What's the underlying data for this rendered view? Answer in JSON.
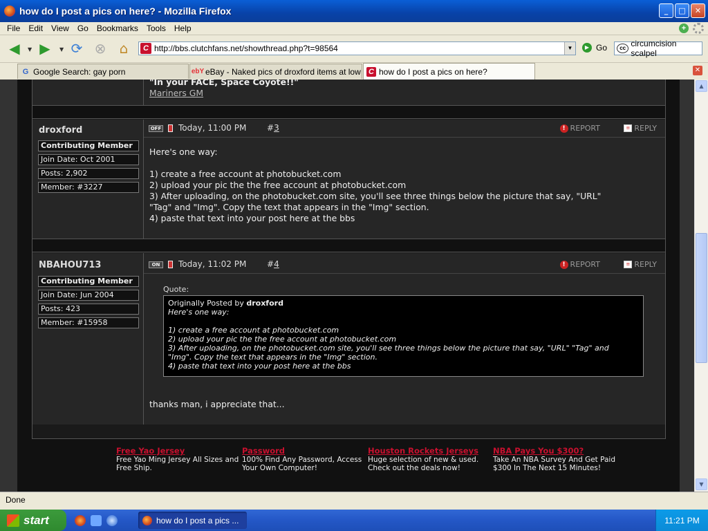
{
  "window": {
    "title": "how do I post a pics on here? - Mozilla Firefox"
  },
  "menu": [
    "File",
    "Edit",
    "View",
    "Go",
    "Bookmarks",
    "Tools",
    "Help"
  ],
  "toolbar": {
    "url": "http://bbs.clutchfans.net/showthread.php?t=98564",
    "go_label": "Go",
    "search_value": "circumcision scalpel"
  },
  "tabs": [
    {
      "label": "Google Search: gay porn",
      "icon": "google-icon"
    },
    {
      "label": "eBay - Naked pics of droxford items at low ...",
      "icon": "ebay-icon"
    },
    {
      "label": "how do I post a pics on here?",
      "icon": "clutchfans-icon",
      "active": true
    }
  ],
  "prev_post": {
    "signature_bold": "\"In your FACE, Space Coyote!!\"",
    "signature_link": "Mariners GM"
  },
  "posts": [
    {
      "username": "droxford",
      "user_title": "Contributing Member",
      "join_date": "Join Date: Oct 2001",
      "posts": "Posts: 2,902",
      "member": "Member: #3227",
      "status": "OFF",
      "date": "Today, 11:00 PM",
      "number_prefix": "#",
      "number": "3",
      "report_label": "REPORT",
      "reply_label": "REPLY",
      "body": "Here's one way:\n\n1) create a free account at photobucket.com\n2) upload your pic the the free account at photobucket.com\n3) After uploading, on the photobucket.com site, you'll see three things below the picture that say, \"URL\"\n\"Tag\" and \"Img\". Copy the text that appears in the \"Img\" section.\n4) paste that text into your post here at the bbs"
    },
    {
      "username": "NBAHOU713",
      "user_title": "Contributing Member",
      "join_date": "Join Date: Jun 2004",
      "posts": "Posts: 423",
      "member": "Member: #15958",
      "status": "ON",
      "date": "Today, 11:02 PM",
      "number_prefix": "#",
      "number": "4",
      "report_label": "REPORT",
      "reply_label": "REPLY",
      "quote_label": "Quote:",
      "quote_prefix": "Originally Posted by ",
      "quote_author": "droxford",
      "quote_body": "Here's one way:\n\n1) create a free account at photobucket.com\n2) upload your pic the the free account at photobucket.com\n3) After uploading, on the photobucket.com site, you'll see three things below the picture that say, \"URL\" \"Tag\" and\n\"Img\". Copy the text that appears in the \"Img\" section.\n4) paste that text into your post here at the bbs",
      "body": "thanks man, i appreciate that..."
    }
  ],
  "ads": [
    {
      "title": "Free Yao Jersey",
      "desc": "Free Yao Ming Jersey All Sizes and Free Ship."
    },
    {
      "title": "Password",
      "desc": "100% Find Any Password, Access Your Own Computer!"
    },
    {
      "title": "Houston Rockets Jerseys",
      "desc": "Huge selection of new & used. Check out the deals now!"
    },
    {
      "title": "NBA Pays You $300?",
      "desc": "Take An NBA Survey And Get Paid $300 In The Next 15 Minutes!"
    }
  ],
  "status_bar": "Done",
  "taskbar": {
    "start_label": "start",
    "task_item": "how do I post a pics ...",
    "clock": "11:21 PM"
  },
  "colors": {
    "accent_red": "#c8102e",
    "forum_bg": "#262626"
  }
}
